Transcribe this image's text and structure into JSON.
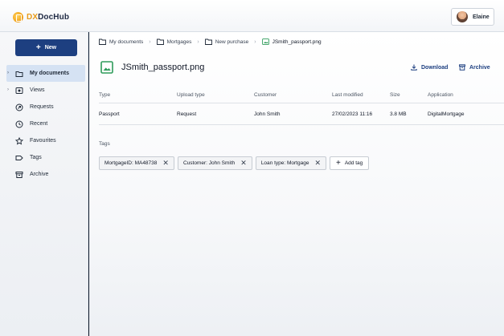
{
  "app": {
    "logo_dx": "DX",
    "logo_rest": "DocHub"
  },
  "user": {
    "name": "Elaine"
  },
  "sidebar": {
    "new_label": "New",
    "items": [
      {
        "label": "My documents",
        "icon": "folder-icon"
      },
      {
        "label": "Views",
        "icon": "views-icon"
      },
      {
        "label": "Requests",
        "icon": "requests-icon"
      },
      {
        "label": "Recent",
        "icon": "clock-icon"
      },
      {
        "label": "Favourites",
        "icon": "star-icon"
      },
      {
        "label": "Tags",
        "icon": "tag-icon"
      },
      {
        "label": "Archive",
        "icon": "archive-icon"
      }
    ]
  },
  "breadcrumb": [
    "My documents",
    "Mortgages",
    "New purchase",
    "JSmith_passport.png"
  ],
  "file": {
    "name": "JSmith_passport.png",
    "download_label": "Download",
    "archive_label": "Archive"
  },
  "table": {
    "headers": [
      "Type",
      "Upload type",
      "Customer",
      "Last modified",
      "Size",
      "Application"
    ],
    "row": [
      "Passport",
      "Request",
      "John Smith",
      "27/02/2023 11:16",
      "3.8 MB",
      "DigitalMortgage"
    ]
  },
  "tags": {
    "label": "Tags",
    "items": [
      "MortgageID: MA48738",
      "Customer: John Smith",
      "Loan type: Mortgage"
    ],
    "add_label": "Add tag"
  },
  "colors": {
    "accent": "#1d3f80",
    "brand": "#e79b1a",
    "file_icon": "#2e9b5a"
  }
}
